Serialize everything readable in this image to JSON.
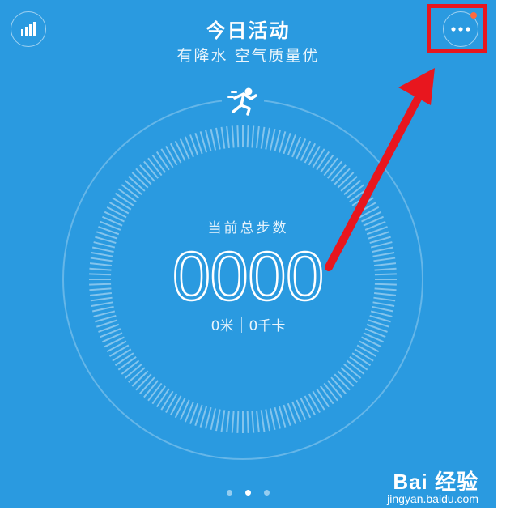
{
  "header": {
    "title": "今日活动",
    "subtitle": "有降水 空气质量优"
  },
  "steps": {
    "label": "当前总步数",
    "value": "0000",
    "distance": "0米",
    "calories": "0千卡"
  },
  "pager": {
    "count": 3,
    "active_index": 1
  },
  "watermark": {
    "brand": "Bai 经验",
    "domain": "jingyan.baidu.com"
  },
  "colors": {
    "background": "#2a9ae0",
    "annotation_red": "#e8161e",
    "notification_dot": "#ff6a3d"
  },
  "icons": {
    "stats": "bar-chart-icon",
    "more": "more-dots-icon",
    "activity": "running-person-icon",
    "watermark": "paw-icon"
  }
}
